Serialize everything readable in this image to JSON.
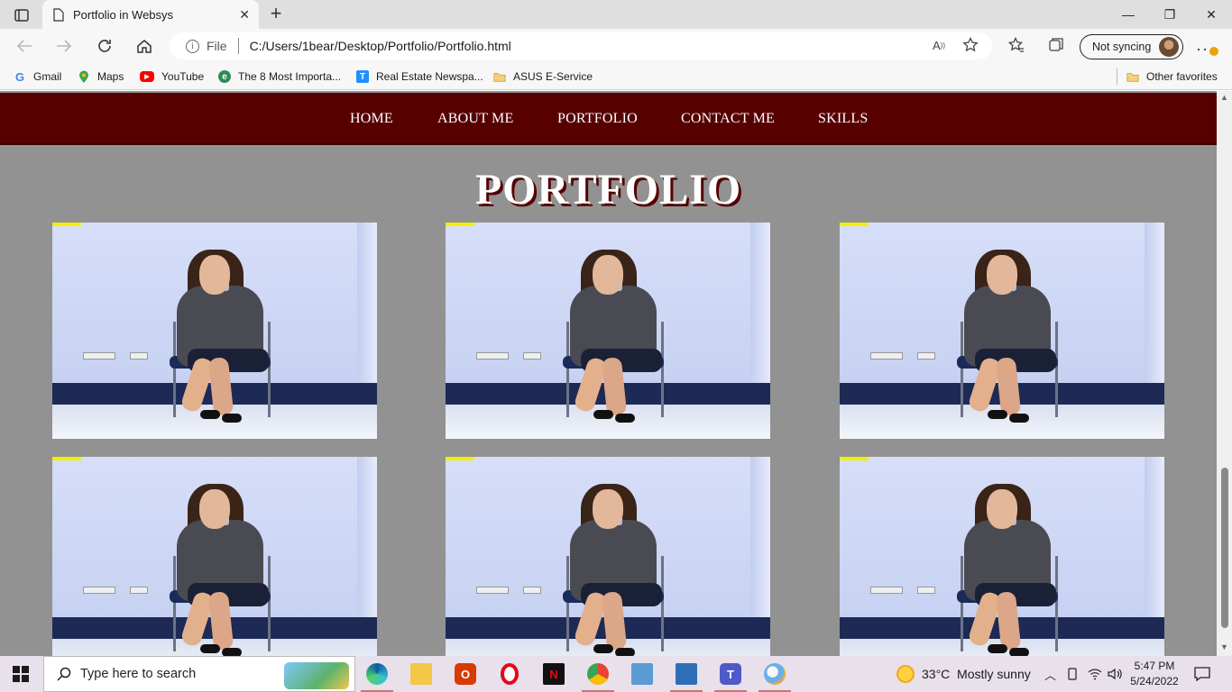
{
  "browser": {
    "tab_title": "Portfolio in Websys",
    "address_scheme": "File",
    "address_url": "C:/Users/1bear/Desktop/Portfolio/Portfolio.html",
    "sync_label": "Not syncing",
    "favorites": [
      {
        "label": "Gmail",
        "icon": "gmail-icon",
        "color": "#4285f4"
      },
      {
        "label": "Maps",
        "icon": "maps-icon",
        "color": "#34a853"
      },
      {
        "label": "YouTube",
        "icon": "youtube-icon",
        "color": "#ff0000"
      },
      {
        "label": "The 8 Most Importa...",
        "icon": "site-icon",
        "color": "#2e8b57"
      },
      {
        "label": "Real Estate Newspa...",
        "icon": "site-icon",
        "color": "#1e90ff"
      },
      {
        "label": "ASUS E-Service",
        "icon": "folder-icon",
        "color": "#e8c25a"
      }
    ],
    "other_favorites": "Other favorites"
  },
  "site": {
    "nav": [
      "HOME",
      "ABOUT ME",
      "PORTFOLIO",
      "CONTACT ME",
      "SKILLS"
    ],
    "heading": "PORTFOLIO",
    "nav_color": "#560000",
    "background": "#929292"
  },
  "taskbar": {
    "search_placeholder": "Type here to search",
    "weather": "33°C  Mostly sunny",
    "time": "5:47 PM",
    "date": "5/24/2022"
  }
}
